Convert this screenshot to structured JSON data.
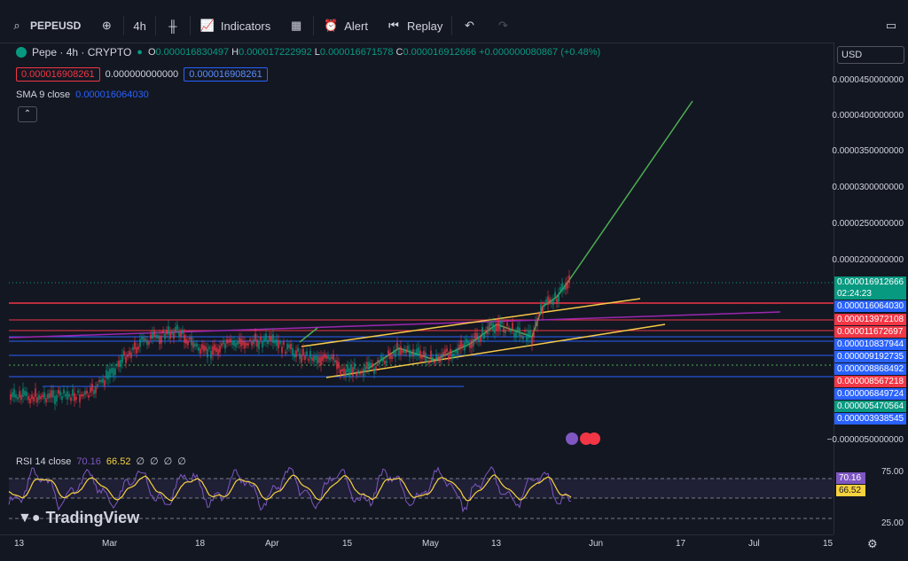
{
  "toolbar": {
    "symbol": "PEPEUSD",
    "interval": "4h",
    "indicators_label": "Indicators",
    "alert_label": "Alert",
    "replay_label": "Replay"
  },
  "legend": {
    "title": "Pepe · 4h · CRYPTO",
    "o_label": "O",
    "o_value": "0.000016830497",
    "h_label": "H",
    "h_value": "0.000017222992",
    "l_label": "L",
    "l_value": "0.000016671578",
    "c_label": "C",
    "c_value": "0.000016912666",
    "change": "+0.000000080867 (+0.48%)",
    "sell_price": "0.000016908261",
    "spread": "0.000000000000",
    "buy_price": "0.000016908261",
    "sma_label": "SMA 9 close",
    "sma_value": "0.000016064030"
  },
  "currency": "USD",
  "price_axis": {
    "ticks": [
      "0.0000450000000",
      "0.0000400000000",
      "0.0000350000000",
      "0.0000300000000",
      "0.0000250000000",
      "0.0000200000000",
      "−0.0000050000000"
    ],
    "current_price": "0.000016912666",
    "countdown": "02:24:23",
    "tags": [
      {
        "value": "0.000016064030",
        "color": "#2962ff"
      },
      {
        "value": "0.000013972108",
        "color": "#f23645"
      },
      {
        "value": "0.000011672697",
        "color": "#f23645"
      },
      {
        "value": "0.000010837944",
        "color": "#2962ff"
      },
      {
        "value": "0.000009192735",
        "color": "#2962ff"
      },
      {
        "value": "0.000008868492",
        "color": "#2962ff"
      },
      {
        "value": "0.000008567218",
        "color": "#f23645"
      },
      {
        "value": "0.000006849724",
        "color": "#2962ff"
      },
      {
        "value": "0.000005470564",
        "color": "#089981"
      },
      {
        "value": "0.000003938545",
        "color": "#2962ff"
      }
    ]
  },
  "rsi": {
    "label": "RSI 14 close",
    "value": "70.16",
    "sma_value": "66.52",
    "ticks": [
      "75.00",
      "25.00"
    ],
    "placeholders": [
      "∅",
      "∅",
      "∅",
      "∅"
    ]
  },
  "time_axis": [
    "13",
    "Mar",
    "18",
    "Apr",
    "15",
    "May",
    "13",
    "Jun",
    "17",
    "Jul",
    "15"
  ],
  "branding": "TradingView",
  "colors": {
    "up": "#089981",
    "down": "#f23645",
    "sma": "#2962ff",
    "rsi": "#7e57c2",
    "rsi_ma": "#f7d23e",
    "trend": "#f7c948",
    "target": "#4caf50"
  }
}
